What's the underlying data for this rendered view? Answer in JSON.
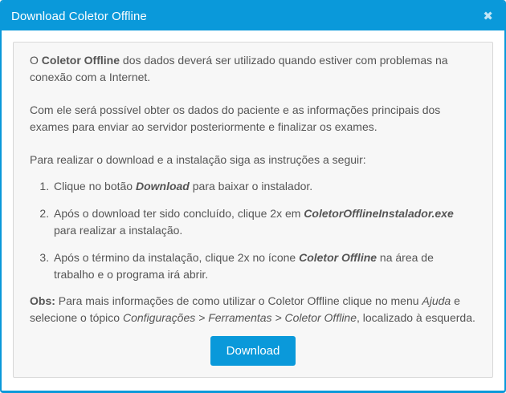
{
  "dialog": {
    "title": "Download Coletor Offline",
    "close_icon": "✖",
    "colors": {
      "accent_blue": "#0a99da",
      "panel_background": "#f7f7f7",
      "panel_border": "#d8d8d8",
      "body_text": "#555555"
    }
  },
  "content": {
    "p1": {
      "pre": "O ",
      "strong": "Coletor Offline",
      "post": " dos dados deverá ser utilizado quando estiver com problemas na conexão com a Internet."
    },
    "p2": "Com ele será possível obter os dados do paciente e as informações principais dos exames para enviar ao servidor posteriormente e finalizar os exames.",
    "p3": "Para realizar o download e a instalação siga as instruções a seguir:",
    "steps": [
      {
        "pre": "Clique no botão ",
        "em": "Download",
        "post": " para baixar o instalador."
      },
      {
        "pre": "Após o download ter sido concluído, clique 2x em ",
        "em": "ColetorOfflineInstalador.exe",
        "post": " para realizar a instalação."
      },
      {
        "pre": "Após o término da instalação, clique 2x no ícone ",
        "em": "Coletor Offline",
        "post": " na área de trabalho e o programa irá abrir."
      }
    ],
    "obs": {
      "label": "Obs:",
      "t1": " Para mais informações de como utilizar o Coletor Offline clique no menu ",
      "menu": "Ajuda",
      "t2": " e selecione o tópico ",
      "path": "Configurações > Ferramentas > Coletor Offline",
      "t3": ", localizado à esquerda."
    },
    "download_button_label": "Download"
  }
}
